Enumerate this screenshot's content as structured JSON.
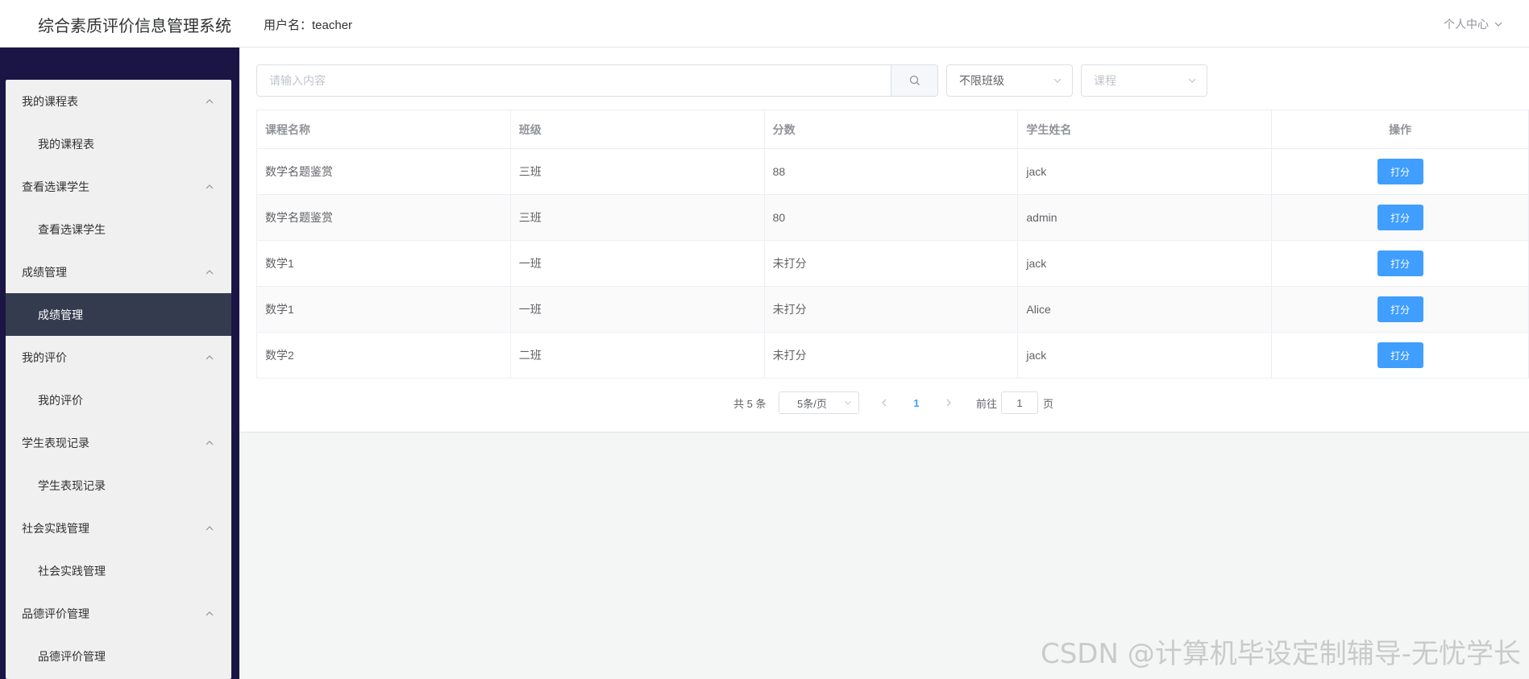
{
  "header": {
    "app_title": "综合素质评价信息管理系统",
    "username_label": "用户名：teacher",
    "personal_center": "个人中心"
  },
  "sidebar": {
    "groups": [
      {
        "label": "我的课程表",
        "item": "我的课程表",
        "active": false
      },
      {
        "label": "查看选课学生",
        "item": "查看选课学生",
        "active": false
      },
      {
        "label": "成绩管理",
        "item": "成绩管理",
        "active": true
      },
      {
        "label": "我的评价",
        "item": "我的评价",
        "active": false
      },
      {
        "label": "学生表现记录",
        "item": "学生表现记录",
        "active": false
      },
      {
        "label": "社会实践管理",
        "item": "社会实践管理",
        "active": false
      },
      {
        "label": "品德评价管理",
        "item": "品德评价管理",
        "active": false
      }
    ]
  },
  "filters": {
    "search_placeholder": "请输入内容",
    "class_select": "不限班级",
    "course_select": "课程"
  },
  "table": {
    "headers": [
      "课程名称",
      "班级",
      "分数",
      "学生姓名",
      "操作"
    ],
    "rows": [
      {
        "course": "数学名题鉴赏",
        "class": "三班",
        "score": "88",
        "student": "jack",
        "action": "打分"
      },
      {
        "course": "数学名题鉴赏",
        "class": "三班",
        "score": "80",
        "student": "admin",
        "action": "打分"
      },
      {
        "course": "数学1",
        "class": "一班",
        "score": "未打分",
        "student": "jack",
        "action": "打分"
      },
      {
        "course": "数学1",
        "class": "一班",
        "score": "未打分",
        "student": "Alice",
        "action": "打分"
      },
      {
        "course": "数学2",
        "class": "二班",
        "score": "未打分",
        "student": "jack",
        "action": "打分"
      }
    ]
  },
  "pagination": {
    "total_text": "共 5 条",
    "page_size": "5条/页",
    "current_page": "1",
    "goto_label": "前往",
    "jump_value": "1",
    "page_unit": "页"
  },
  "watermark": "CSDN @计算机毕设定制辅导-无忧学长",
  "colors": {
    "sidebar_bg": "#1a1544",
    "active_item": "#353b4f",
    "primary": "#409eff"
  },
  "icons": [
    "search-icon",
    "chevron-down-icon",
    "chevron-up-icon",
    "chevron-left-icon",
    "chevron-right-icon"
  ]
}
